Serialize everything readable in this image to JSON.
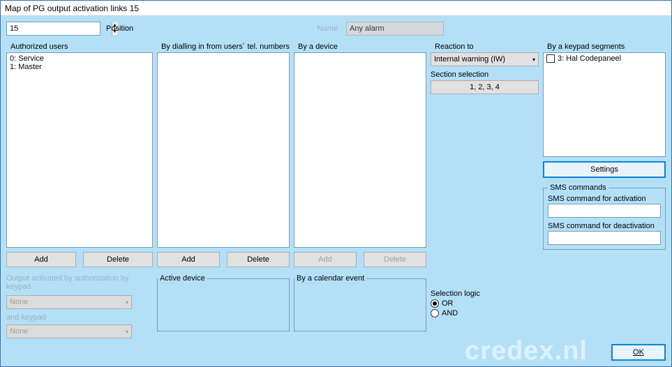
{
  "titlebar": "Map of PG output activation links 15",
  "top": {
    "position_value": "15",
    "position_label": "Position",
    "name_label": "Name",
    "name_value": "Any alarm"
  },
  "authUsers": {
    "label": "Authorized users",
    "items": [
      "0: Service",
      "1: Master"
    ],
    "add": "Add",
    "delete": "Delete"
  },
  "dialling": {
    "label": "By dialling in from users´ tel. numbers",
    "add": "Add",
    "delete": "Delete"
  },
  "byDevice": {
    "label": "By a device",
    "add": "Add",
    "delete": "Delete"
  },
  "reaction": {
    "label": "Reaction to",
    "value": "Internal warning (IW)",
    "sectionLabel": "Section selection",
    "sectionValue": "1, 2, 3, 4"
  },
  "logic": {
    "label": "Selection logic",
    "or": "OR",
    "and": "AND"
  },
  "keypad": {
    "label": "By a keypad segments",
    "item": "3: Hal Codepaneel",
    "settings": "Settings"
  },
  "sms": {
    "group": "SMS commands",
    "activation": "SMS command for activation",
    "deactivation": "SMS command for deactivation"
  },
  "auth": {
    "line1": "Output activated by authorization by keypad",
    "none1": "None",
    "andKeypad": "and keypad",
    "none2": "None"
  },
  "activeDevice": {
    "label": "Active device"
  },
  "calendar": {
    "label": "By a calendar event"
  },
  "ok": "OK",
  "watermark": "credex.nl"
}
